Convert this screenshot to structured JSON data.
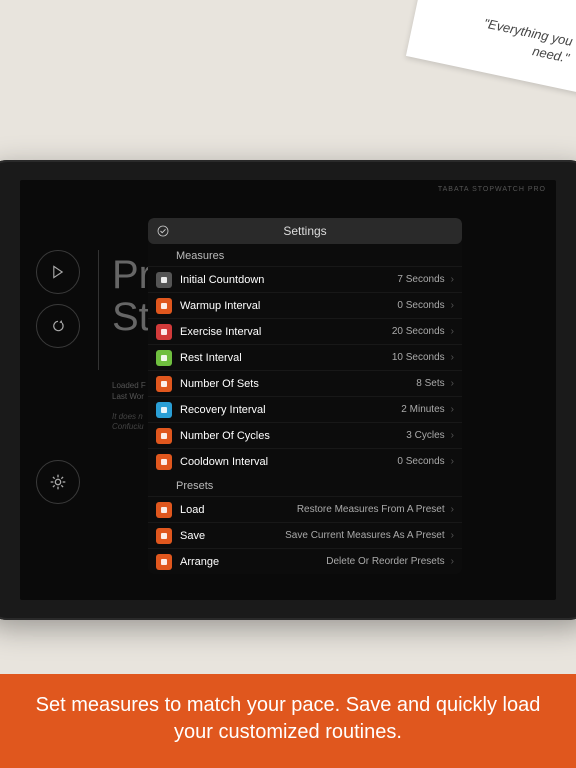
{
  "corner_quote": "\"Everything you need.\"",
  "app_title": "TABATA STOPWATCH PRO",
  "bg_title": "Pr\nSt",
  "bg_meta_line1": "Loaded F",
  "bg_meta_line2": "Last Wor",
  "bg_quote_line1": "It does n",
  "bg_quote_author": "Confuciu",
  "panel": {
    "header_title": "Settings",
    "sections": {
      "measures_header": "Measures",
      "presets_header": "Presets"
    },
    "measures": [
      {
        "label": "Initial Countdown",
        "value": "7 Seconds",
        "color": "#555555"
      },
      {
        "label": "Warmup Interval",
        "value": "0 Seconds",
        "color": "#e0571e"
      },
      {
        "label": "Exercise Interval",
        "value": "20 Seconds",
        "color": "#d13a3a"
      },
      {
        "label": "Rest Interval",
        "value": "10 Seconds",
        "color": "#6fbf3f"
      },
      {
        "label": "Number Of Sets",
        "value": "8 Sets",
        "color": "#e0571e"
      },
      {
        "label": "Recovery Interval",
        "value": "2 Minutes",
        "color": "#2a9fd6"
      },
      {
        "label": "Number Of Cycles",
        "value": "3 Cycles",
        "color": "#e0571e"
      },
      {
        "label": "Cooldown Interval",
        "value": "0 Seconds",
        "color": "#e0571e"
      }
    ],
    "presets": [
      {
        "label": "Load",
        "value": "Restore Measures From A Preset",
        "color": "#e0571e"
      },
      {
        "label": "Save",
        "value": "Save Current Measures As A Preset",
        "color": "#e0571e"
      },
      {
        "label": "Arrange",
        "value": "Delete Or Reorder Presets",
        "color": "#e0571e"
      }
    ]
  },
  "banner": "Set measures to match your pace. Save and quickly load your customized routines."
}
